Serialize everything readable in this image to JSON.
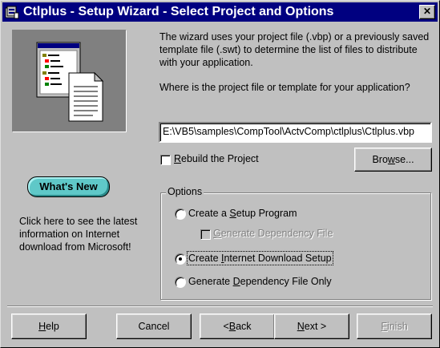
{
  "window": {
    "title": "Ctlplus - Setup Wizard - Select Project and Options",
    "close_glyph": "✕",
    "app_icon": "setup-wizard-icon"
  },
  "intro": {
    "paragraph": "The wizard uses your project file (.vbp) or a previously saved template file (.swt) to determine the list of files to distribute with your application.",
    "question": "Where is the project file or template for your application?"
  },
  "project_path": {
    "value": "E:\\VB5\\samples\\CompTool\\ActvComp\\ctlplus\\Ctlplus.vbp"
  },
  "rebuild": {
    "label_prefix": "",
    "label_key": "R",
    "label_rest": "ebuild the Project",
    "checked": false
  },
  "browse_button": {
    "prefix": "Bro",
    "key": "w",
    "rest": "se..."
  },
  "whats_new": {
    "label": "What's New",
    "description": "Click here to see the latest information on Internet download from Microsoft!"
  },
  "options": {
    "group_label": "Options",
    "setup_program": {
      "prefix": "Create a ",
      "key": "S",
      "rest": "etup Program",
      "selected": false
    },
    "generate_dependency": {
      "prefix": "",
      "key": "G",
      "rest": "enerate Dependency File",
      "checked": false,
      "enabled": false
    },
    "internet_download": {
      "prefix": "Create ",
      "key": "I",
      "rest": "nternet Download Setup",
      "selected": true
    },
    "dependency_only": {
      "prefix": "Generate ",
      "key": "D",
      "rest": "ependency File Only",
      "selected": false
    }
  },
  "buttons": {
    "help": {
      "prefix": "",
      "key": "H",
      "rest": "elp"
    },
    "cancel": {
      "label": "Cancel"
    },
    "back": {
      "prefix": "< ",
      "key": "B",
      "rest": "ack"
    },
    "next": {
      "prefix": "",
      "key": "N",
      "rest": "ext >"
    },
    "finish": {
      "prefix": "",
      "key": "F",
      "rest": "inish",
      "enabled": false
    }
  }
}
